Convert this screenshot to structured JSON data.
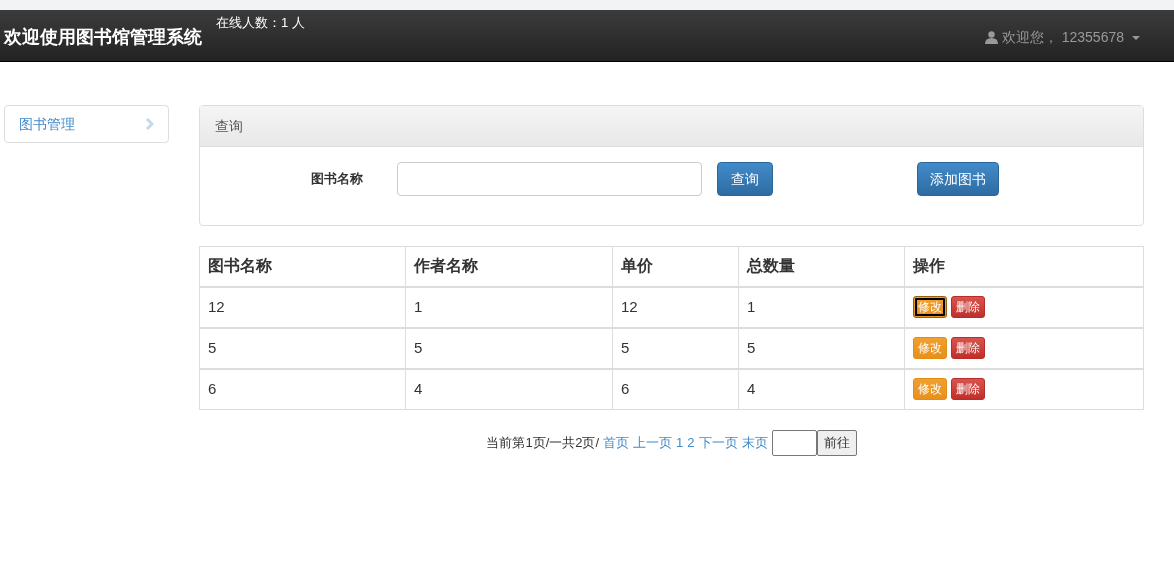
{
  "navbar": {
    "brand": "欢迎使用图书馆管理系统",
    "online": "在线人数：1 人",
    "user": "欢迎您， 12355678"
  },
  "sidebar": {
    "items": [
      {
        "label": "图书管理",
        "selected": false
      }
    ]
  },
  "query": {
    "title": "查询",
    "field_label": "图书名称",
    "search_button": "查询",
    "add_button": "添加图书"
  },
  "table": {
    "columns": [
      "图书名称",
      "作者名称",
      "单价",
      "总数量",
      "操作"
    ],
    "rows": [
      {
        "cells": [
          "12",
          "1",
          "12",
          "1"
        ],
        "edit": "修改",
        "delete": "删除",
        "focused": true
      },
      {
        "cells": [
          "5",
          "5",
          "5",
          "5"
        ],
        "edit": "修改",
        "delete": "删除",
        "focused": false
      },
      {
        "cells": [
          "6",
          "4",
          "6",
          "4"
        ],
        "edit": "修改",
        "delete": "删除",
        "focused": false
      }
    ]
  },
  "pagination": {
    "info": "当前第1页/一共2页/",
    "links": [
      "首页",
      "上一页",
      "1",
      "2",
      "下一页",
      "末页"
    ],
    "go_button": "前往"
  }
}
